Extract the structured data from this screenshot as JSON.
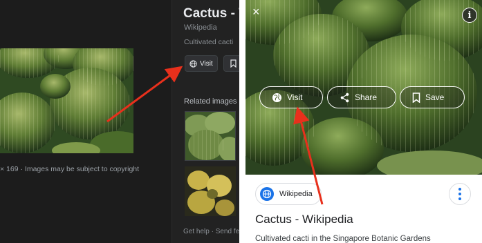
{
  "desktop": {
    "title": "Cactus - Wi",
    "source": "Wikipedia",
    "description": "Cultivated cacti",
    "visit_label": "Visit",
    "related_label": "Related images",
    "caption": "× 169  ·  Images may be subject to copyright",
    "footer": "Get help  ·  Send fe",
    "colors": {
      "background": "#222222",
      "text": "#e8eaed",
      "muted": "#8a8f94"
    }
  },
  "mobile": {
    "close_glyph": "×",
    "info_glyph": "i",
    "actions": [
      {
        "label": "Visit",
        "icon": "globe-icon"
      },
      {
        "label": "Share",
        "icon": "share-icon"
      },
      {
        "label": "Save",
        "icon": "bookmark-icon"
      }
    ],
    "source_chip": "Wikipedia",
    "title": "Cactus - Wikipedia",
    "description": "Cultivated cacti in the Singapore Botanic Gardens",
    "colors": {
      "accent": "#1a73e8",
      "text": "#202124"
    }
  },
  "annotations": {
    "arrow_color": "#e8301c"
  }
}
